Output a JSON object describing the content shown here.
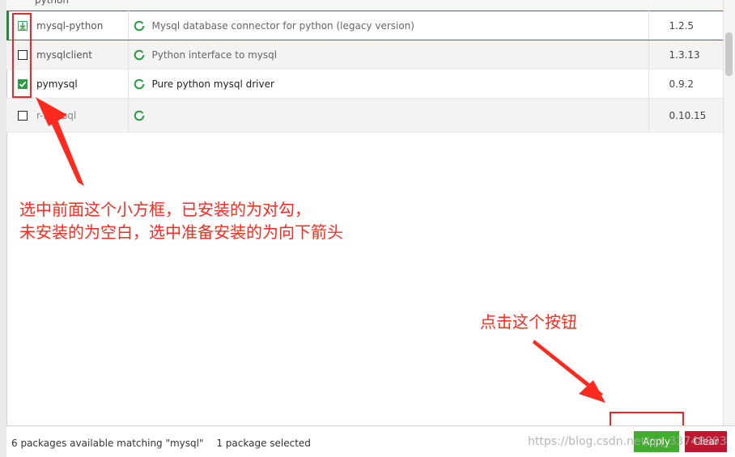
{
  "header": {
    "partial_label": "python"
  },
  "packages": [
    {
      "name": "mysql-python",
      "description": "Mysql database connector for python (legacy version)",
      "version": "1.2.5",
      "state": "marked-for-install"
    },
    {
      "name": "mysqlclient",
      "description": "Python interface to mysql",
      "version": "1.3.13",
      "state": "not-installed"
    },
    {
      "name": "pymysql",
      "description": "Pure python mysql driver",
      "version": "0.9.2",
      "state": "installed"
    },
    {
      "name": "r-rmysql",
      "description": "",
      "version": "0.10.15",
      "state": "not-installed"
    }
  ],
  "annotations": {
    "checkbox_note_line1": "选中前面这个小方框，已安装的为对勾，",
    "checkbox_note_line2": "未安装的为空白，选中准备安装的为向下箭头",
    "button_note": "点击这个按钮"
  },
  "status_bar": {
    "matching": "6 packages available matching \"mysql\"",
    "selected": "1 package selected",
    "apply_label": "Apply",
    "clear_label": "Clear"
  },
  "watermark": "https://blog.csdn.net/qq_33748803",
  "colors": {
    "accent_green": "#2e9b45",
    "apply_green": "#3fae2a",
    "clear_red": "#c0162f",
    "annotation_red": "#ff2a1f"
  },
  "icons": {
    "installed": "check-icon",
    "marked": "download-arrow-icon",
    "status": "status-ring-icon"
  }
}
